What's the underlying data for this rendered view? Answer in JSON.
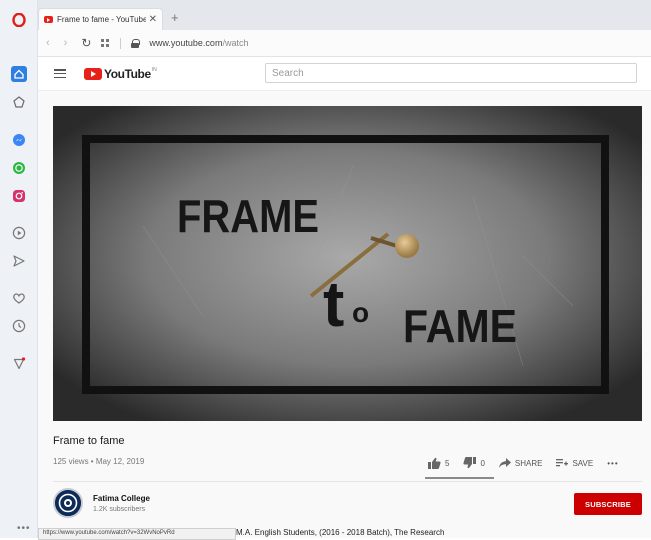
{
  "browser": {
    "tab_title": "Frame to fame - YouTube",
    "new_tab_symbol": "+",
    "tab_close_symbol": "✕",
    "url_host": "www.youtube.com",
    "url_path": "/watch",
    "status_url": "https://www.youtube.com/watch?v=32WvNoPvRd",
    "sidebar_icons": [
      "opera-logo-icon",
      "home-icon",
      "diamond-icon",
      "messenger-icon",
      "whatsapp-icon",
      "instagram-icon",
      "player-icon",
      "send-icon",
      "heart-icon",
      "history-icon",
      "bulb-icon",
      "more-icon"
    ]
  },
  "youtube": {
    "logo_text": "YouTube",
    "country_code": "IN",
    "search_placeholder": "Search",
    "brand_color": "#e62117"
  },
  "video": {
    "thumbnail_text": {
      "frame": "FRAME",
      "to_t": "t",
      "to_o": "o",
      "fame": "FAME"
    },
    "title": "Frame to fame",
    "meta": "125 views • May 12, 2019",
    "likes": "5",
    "dislikes": "0",
    "share_label": "SHARE",
    "save_label": "SAVE",
    "more_label": "•••"
  },
  "channel": {
    "name": "Fatima College",
    "subscribers": "1.2K subscribers",
    "subscribe_label": "SUBSCRIBE",
    "subscribe_color": "#cc0000"
  },
  "description_snippet": "M.A. English Students, (2016 - 2018 Batch), The Research"
}
